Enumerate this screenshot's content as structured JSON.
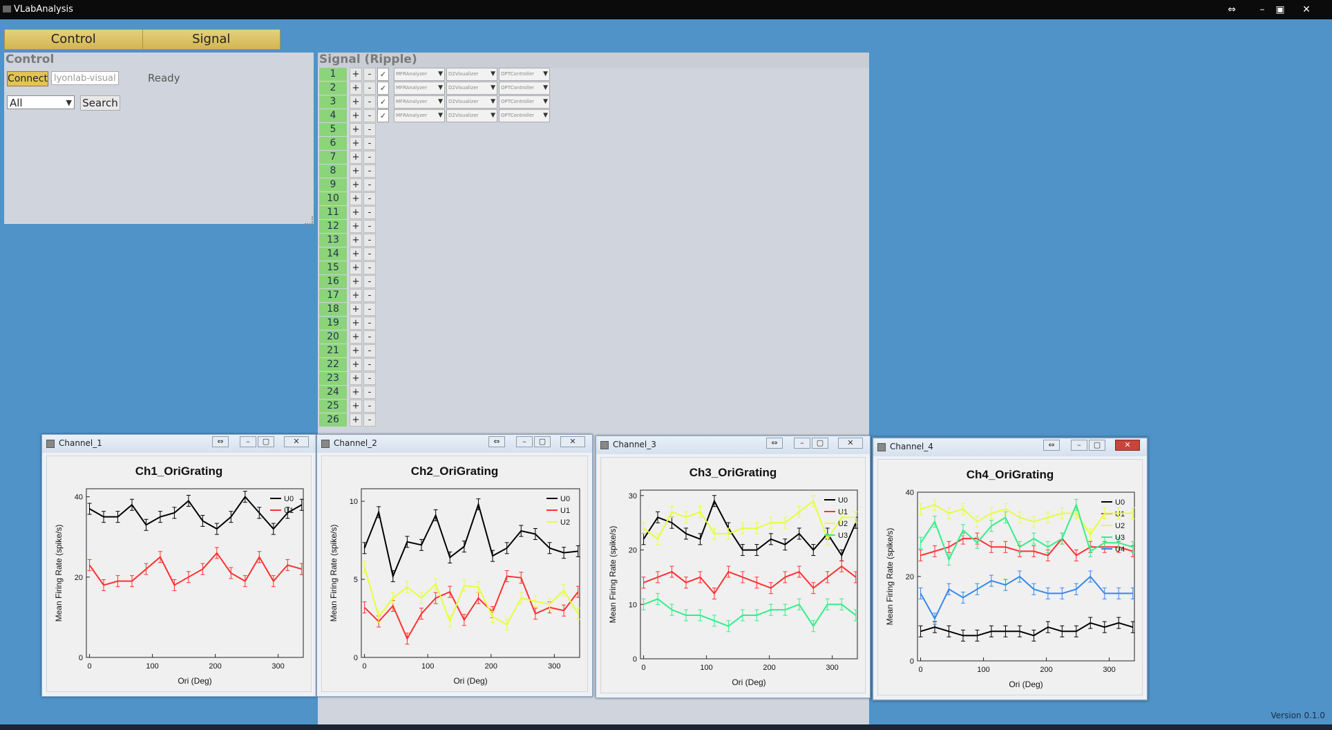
{
  "app": {
    "title": "VLabAnalysis",
    "version": "Version 0.1.0"
  },
  "tabs": [
    "Control",
    "Signal"
  ],
  "control": {
    "title": "Control",
    "connect_label": "Connect",
    "host_value": "lyonlab-visual",
    "status": "Ready",
    "filter_value": "All",
    "search_label": "Search"
  },
  "signal": {
    "title": "Signal (Ripple)",
    "configured_channels": [
      {
        "channel": "1",
        "analyzer": "MFRAnalyzer",
        "visualizer": "D2Visualizer",
        "controller": "OPTController"
      },
      {
        "channel": "2",
        "analyzer": "MFRAnalyzer",
        "visualizer": "D2Visualizer",
        "controller": "OPTController"
      },
      {
        "channel": "3",
        "analyzer": "MFRAnalyzer",
        "visualizer": "D2Visualizer",
        "controller": "OPTController"
      },
      {
        "channel": "4",
        "analyzer": "MFRAnalyzer",
        "visualizer": "D2Visualizer",
        "controller": "OPTController"
      }
    ],
    "channels": [
      "1",
      "2",
      "3",
      "4",
      "5",
      "6",
      "7",
      "8",
      "9",
      "10",
      "11",
      "12",
      "13",
      "14",
      "15",
      "16",
      "17",
      "18",
      "19",
      "20",
      "21",
      "22",
      "23",
      "24",
      "25",
      "26"
    ],
    "plus_label": "+",
    "minus_label": "-"
  },
  "windows": [
    {
      "title": "Channel_1"
    },
    {
      "title": "Channel_2"
    },
    {
      "title": "Channel_3"
    },
    {
      "title": "Channel_4"
    }
  ],
  "series_colors": {
    "U0": "#000000",
    "U1": "#ff3030",
    "U2": "#e6ff3a",
    "U3": "#33ee88",
    "U4": "#3388ee"
  },
  "chart_data": [
    {
      "type": "line",
      "title": "Ch1_OriGrating",
      "xlabel": "Ori (Deg)",
      "ylabel": "Mean Firing Rate (spike/s)",
      "xlim": [
        -5,
        340
      ],
      "ylim": [
        0,
        42
      ],
      "xticks": [
        0,
        100,
        200,
        300
      ],
      "yticks": [
        0,
        20,
        40
      ],
      "x": [
        0,
        22.5,
        45,
        67.5,
        90,
        112.5,
        135,
        157.5,
        180,
        202.5,
        225,
        247.5,
        270,
        292.5,
        315,
        337.5
      ],
      "legend_position": "top-right",
      "series": [
        {
          "name": "U0",
          "values": [
            37,
            35,
            35,
            38,
            33,
            35,
            36,
            39,
            34,
            32,
            35,
            40,
            36,
            32,
            36,
            38
          ]
        },
        {
          "name": "U1",
          "values": [
            23,
            18,
            19,
            19,
            22,
            25,
            18,
            20,
            22,
            26,
            21,
            19,
            25,
            19,
            23,
            22
          ]
        }
      ]
    },
    {
      "type": "line",
      "title": "Ch2_OriGrating",
      "xlabel": "Ori (Deg)",
      "ylabel": "Mean Firing Rate (spike/s)",
      "xlim": [
        -5,
        340
      ],
      "ylim": [
        0,
        10.8
      ],
      "xticks": [
        0,
        100,
        200,
        300
      ],
      "yticks": [
        0,
        5,
        10
      ],
      "x": [
        0,
        22.5,
        45,
        67.5,
        90,
        112.5,
        135,
        157.5,
        180,
        202.5,
        225,
        247.5,
        270,
        292.5,
        315,
        337.5
      ],
      "legend_position": "top-right",
      "series": [
        {
          "name": "U0",
          "values": [
            7.0,
            9.3,
            5.2,
            7.4,
            7.2,
            9.1,
            6.4,
            7.1,
            9.8,
            6.5,
            7.0,
            8.1,
            7.9,
            7.0,
            6.7,
            6.8
          ]
        },
        {
          "name": "U1",
          "values": [
            3.2,
            2.3,
            3.3,
            1.2,
            2.8,
            3.8,
            4.2,
            2.4,
            3.8,
            2.9,
            5.2,
            5.1,
            2.8,
            3.2,
            3.0,
            4.2
          ]
        },
        {
          "name": "U2",
          "values": [
            5.8,
            2.6,
            3.8,
            4.5,
            3.8,
            4.7,
            2.3,
            4.6,
            4.5,
            2.6,
            2.1,
            3.8,
            3.6,
            3.4,
            4.3,
            2.8
          ]
        }
      ]
    },
    {
      "type": "line",
      "title": "Ch3_OriGrating",
      "xlabel": "Ori (Deg)",
      "ylabel": "Mean Firing Rate (spike/s)",
      "xlim": [
        -5,
        340
      ],
      "ylim": [
        0,
        31
      ],
      "xticks": [
        0,
        100,
        200,
        300
      ],
      "yticks": [
        0,
        10,
        20,
        30
      ],
      "x": [
        0,
        22.5,
        45,
        67.5,
        90,
        112.5,
        135,
        157.5,
        180,
        202.5,
        225,
        247.5,
        270,
        292.5,
        315,
        337.5
      ],
      "legend_position": "top-right",
      "series": [
        {
          "name": "U0",
          "values": [
            22,
            26,
            25,
            23,
            22,
            29,
            24,
            20,
            20,
            22,
            21,
            23,
            20,
            23,
            19,
            25
          ]
        },
        {
          "name": "U1",
          "values": [
            14,
            15,
            16,
            14,
            15,
            12,
            16,
            15,
            14,
            13,
            15,
            16,
            13,
            15,
            17,
            15
          ]
        },
        {
          "name": "U2",
          "values": [
            24,
            22,
            27,
            26,
            27,
            23,
            23,
            24,
            24,
            25,
            25,
            27,
            29,
            22,
            26,
            26
          ]
        },
        {
          "name": "U3",
          "values": [
            10,
            11,
            9,
            8,
            8,
            7,
            6,
            8,
            8,
            9,
            9,
            10,
            6,
            10,
            10,
            8
          ]
        }
      ]
    },
    {
      "type": "line",
      "title": "Ch4_OriGrating",
      "xlabel": "Ori (Deg)",
      "ylabel": "Mean Firing Rate (spike/s)",
      "xlim": [
        -5,
        340
      ],
      "ylim": [
        0,
        40
      ],
      "xticks": [
        0,
        100,
        200,
        300
      ],
      "yticks": [
        0,
        20,
        40
      ],
      "x": [
        0,
        22.5,
        45,
        67.5,
        90,
        112.5,
        135,
        157.5,
        180,
        202.5,
        225,
        247.5,
        270,
        292.5,
        315,
        337.5
      ],
      "legend_position": "top-right",
      "series": [
        {
          "name": "U0",
          "values": [
            7,
            8,
            7,
            6,
            6,
            7,
            7,
            7,
            6,
            8,
            7,
            7,
            9,
            8,
            9,
            8
          ]
        },
        {
          "name": "U1",
          "values": [
            25,
            26,
            27,
            29,
            29,
            27,
            27,
            26,
            26,
            25,
            29,
            25,
            27,
            27,
            27,
            26
          ]
        },
        {
          "name": "U2",
          "values": [
            36,
            37,
            35,
            36,
            33,
            35,
            36,
            34,
            33,
            34,
            35,
            35,
            30,
            35,
            35,
            35
          ]
        },
        {
          "name": "U3",
          "values": [
            28,
            33,
            24,
            31,
            28,
            32,
            34,
            27,
            29,
            27,
            29,
            37,
            26,
            28,
            28,
            27
          ]
        },
        {
          "name": "U4",
          "values": [
            16,
            10,
            17,
            15,
            17,
            19,
            18,
            20,
            17,
            16,
            16,
            17,
            20,
            16,
            16,
            16
          ]
        }
      ]
    }
  ]
}
